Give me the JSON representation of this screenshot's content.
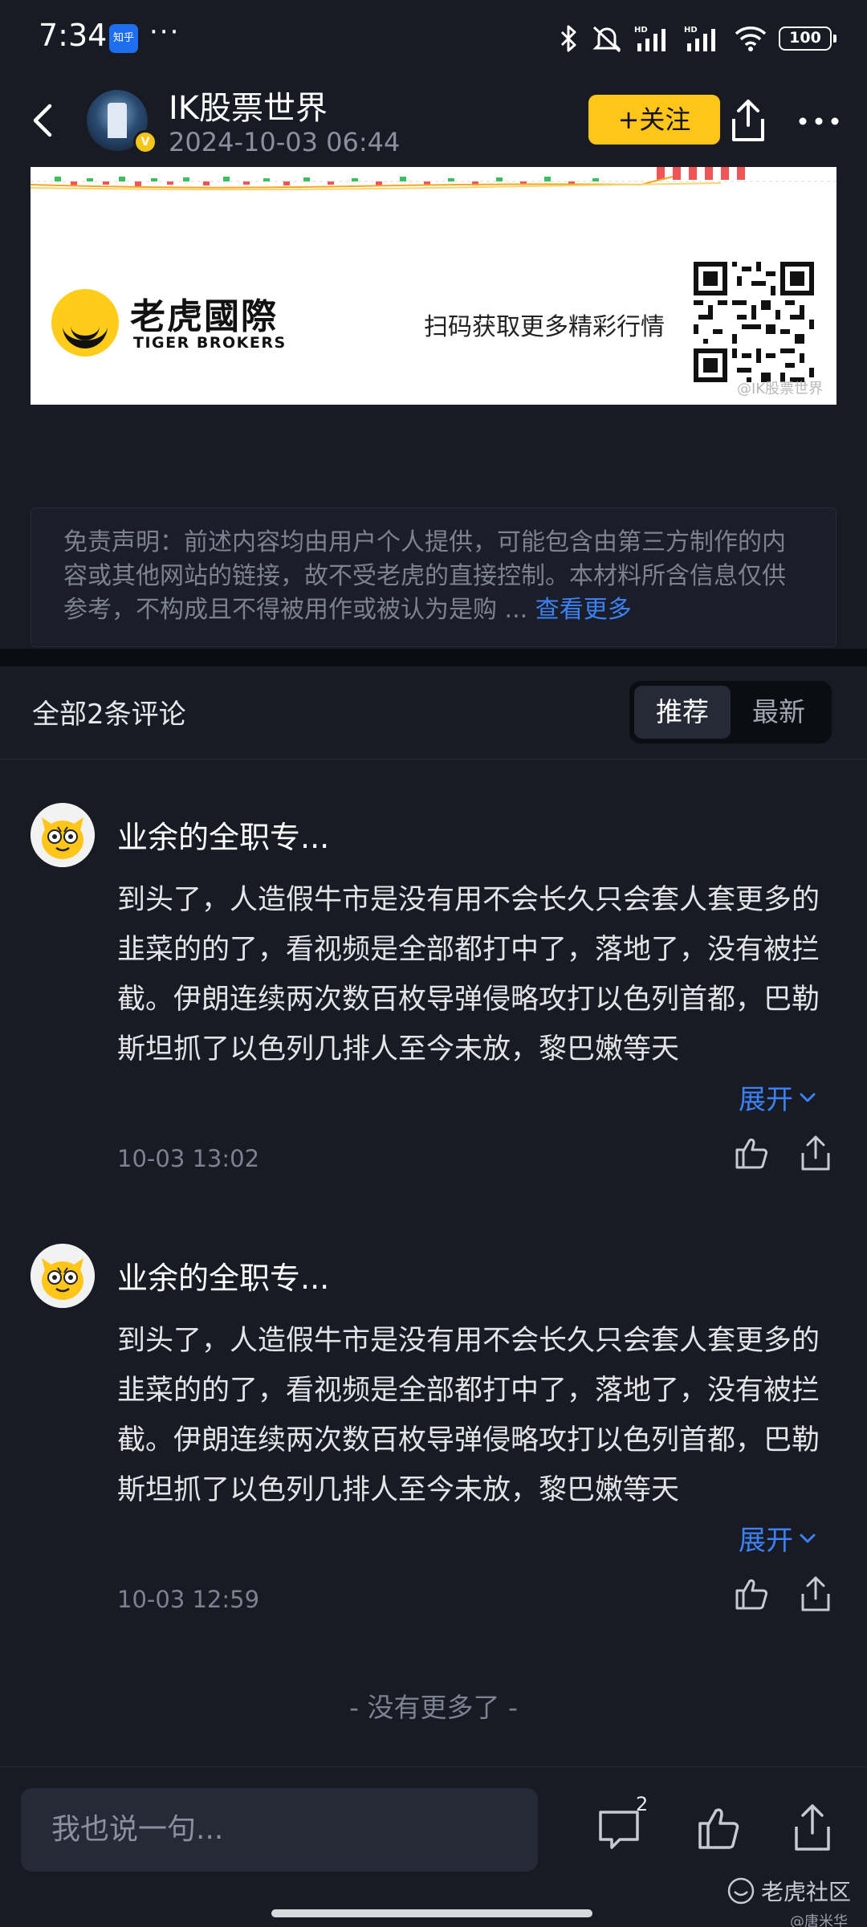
{
  "status_bar": {
    "time": "7:34",
    "app_badge": "知乎",
    "more_dots": "···",
    "battery": "100",
    "icons": [
      "bluetooth-icon",
      "mute-icon",
      "signal-hd-icon",
      "signal-hd-icon",
      "wifi-icon",
      "battery-icon"
    ]
  },
  "header": {
    "author_name": "IK股票世界",
    "post_time": "2024-10-03 06:44",
    "follow_label": "+关注",
    "verified_badge": "V"
  },
  "ad": {
    "brand_cn": "老虎國際",
    "brand_en": "TIGER BROKERS",
    "scan_text": "扫码获取更多精彩行情",
    "watermark": "@IK股票世界"
  },
  "disclaimer": {
    "text": "免责声明：前述内容均由用户个人提供，可能包含由第三方制作的内容或其他网站的链接，故不受老虎的直接控制。本材料所含信息仅供参考，不构成且不得被用作或被认为是购 ...",
    "more_label": "查看更多"
  },
  "comments_header": {
    "count_label": "全部2条评论",
    "sort_recommended": "推荐",
    "sort_latest": "最新"
  },
  "comments": [
    {
      "name": "业余的全职专...",
      "body": "到头了，人造假牛市是没有用不会长久只会套人套更多的韭菜的的了，看视频是全部都打中了，落地了，没有被拦截。伊朗连续两次数百枚导弹侵略攻打以色列首都，巴勒斯坦抓了以色列几排人至今未放，黎巴嫩等天",
      "expand": "展开",
      "date": "10-03 13:02"
    },
    {
      "name": "业余的全职专...",
      "body": "到头了，人造假牛市是没有用不会长久只会套人套更多的韭菜的的了，看视频是全部都打中了，落地了，没有被拦截。伊朗连续两次数百枚导弹侵略攻打以色列首都，巴勒斯坦抓了以色列几排人至今未放，黎巴嫩等天",
      "expand": "展开",
      "date": "10-03 12:59"
    }
  ],
  "no_more": "- 没有更多了 -",
  "bottom_bar": {
    "input_placeholder": "我也说一句...",
    "comment_count": "2",
    "watermark": "老虎社区",
    "watermark_sub": "@唐米华"
  },
  "colors": {
    "background": "#181a24",
    "accent_yellow": "#ffc619",
    "link_blue": "#3b82f6"
  }
}
